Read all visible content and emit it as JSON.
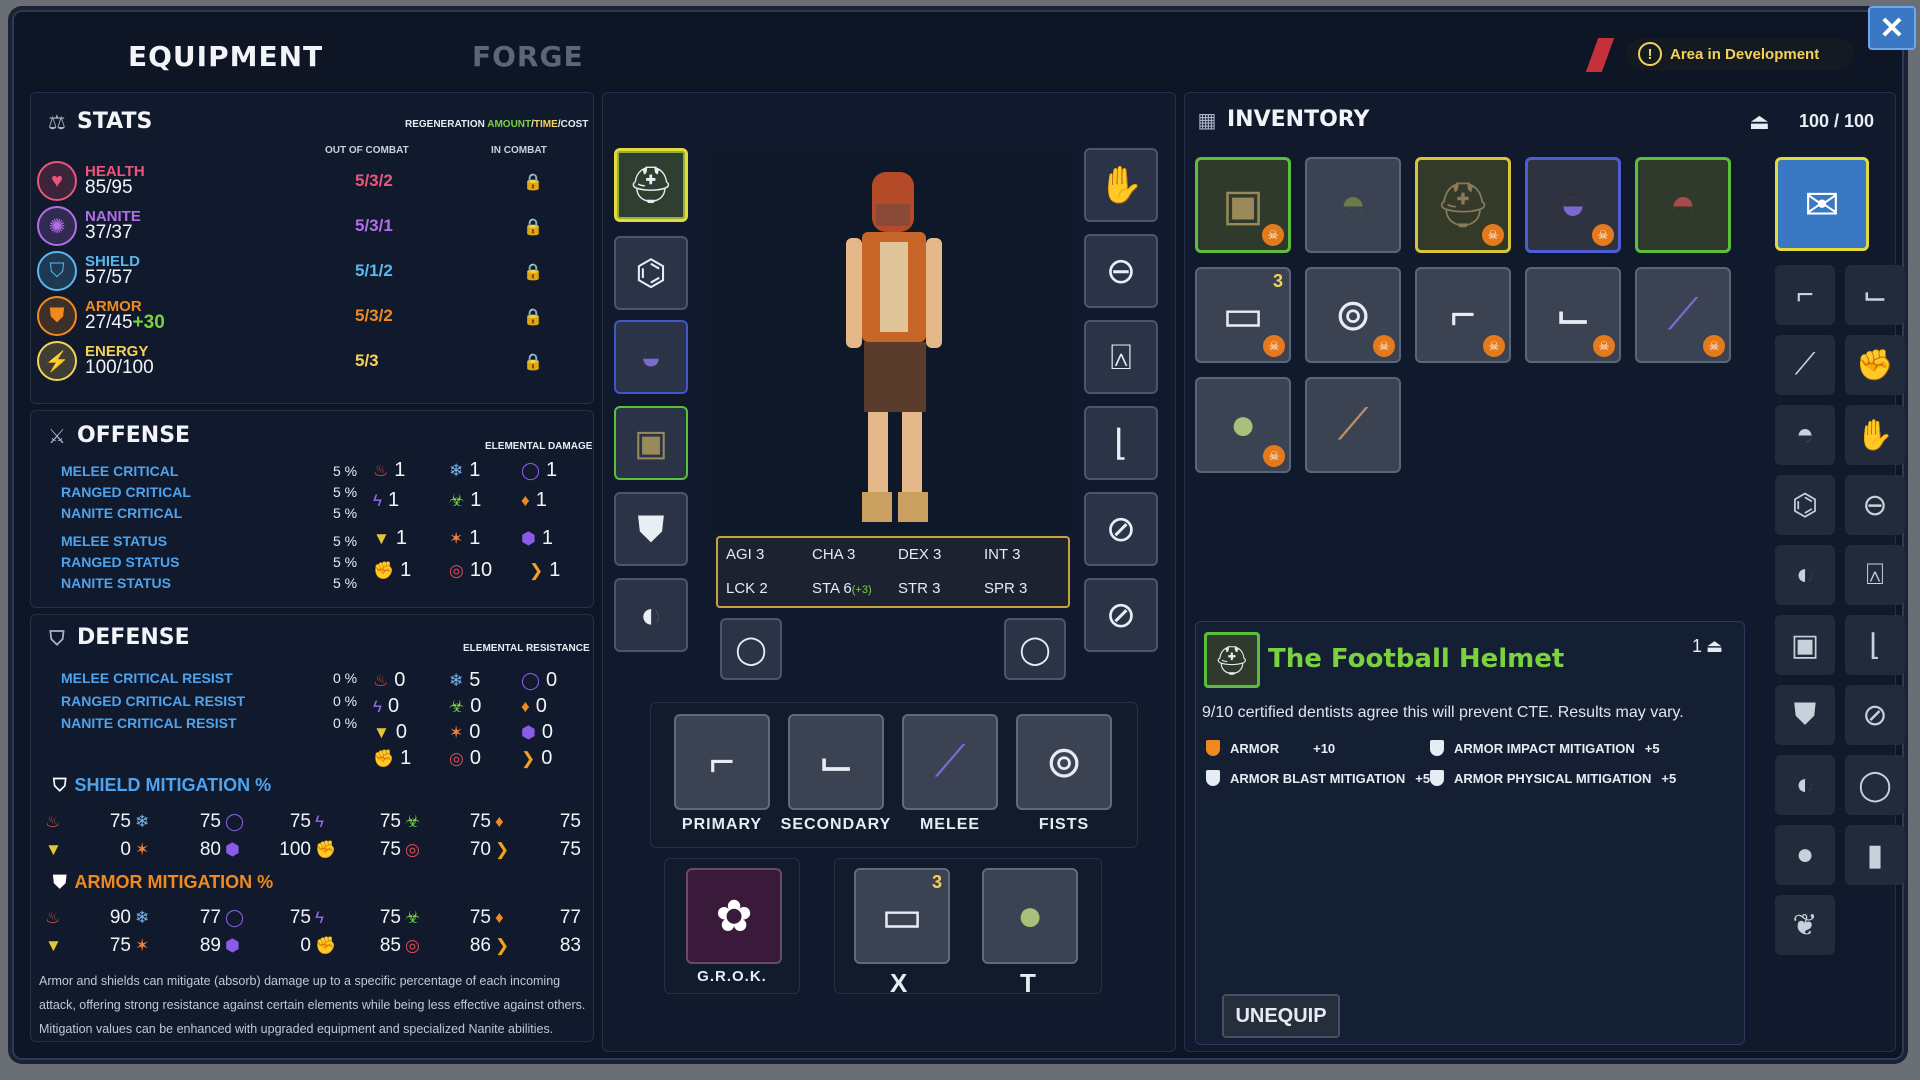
{
  "tabs": {
    "equipment": "EQUIPMENT",
    "forge": "FORGE"
  },
  "dev_notice": "Area in Development",
  "stats": {
    "title": "STATS",
    "regen_header": {
      "prefix": "REGENERATION",
      "amount": "AMOUNT",
      "sep1": "/",
      "time": "TIME",
      "sep2": "/",
      "cost": "COST"
    },
    "col_out": "OUT OF COMBAT",
    "col_in": "IN COMBAT",
    "rows": [
      {
        "name": "HEALTH",
        "value": "85/95",
        "extra": "",
        "regen": "5/3/2",
        "color": "#e9567a"
      },
      {
        "name": "NANITE",
        "value": "37/37",
        "extra": "",
        "regen": "5/3/1",
        "color": "#b26ee8"
      },
      {
        "name": "SHIELD",
        "value": "57/57",
        "extra": "",
        "regen": "5/1/2",
        "color": "#58b8ee"
      },
      {
        "name": "ARMOR",
        "value": "27/45",
        "extra": "+30",
        "regen": "5/3/2",
        "color": "#f08a1e"
      },
      {
        "name": "ENERGY",
        "value": "100/100",
        "extra": "",
        "regen": "5/3",
        "color": "#f4d25a"
      }
    ]
  },
  "offense": {
    "title": "OFFENSE",
    "subtitle": "ELEMENTAL DAMAGE",
    "rows": [
      {
        "label": "MELEE CRITICAL",
        "value": "5 %"
      },
      {
        "label": "RANGED CRITICAL",
        "value": "5 %"
      },
      {
        "label": "NANITE CRITICAL",
        "value": "5 %"
      },
      {
        "label": "MELEE STATUS",
        "value": "5 %"
      },
      {
        "label": "RANGED STATUS",
        "value": "5 %"
      },
      {
        "label": "NANITE STATUS",
        "value": "5 %"
      }
    ],
    "elements": [
      [
        "1",
        "1",
        "1"
      ],
      [
        "1",
        "1",
        "1"
      ],
      [
        "1",
        "1",
        "1"
      ],
      [
        "1",
        "10",
        "1"
      ]
    ]
  },
  "defense": {
    "title": "DEFENSE",
    "subtitle": "ELEMENTAL RESISTANCE",
    "rows": [
      {
        "label": "MELEE CRITICAL RESIST",
        "value": "0 %"
      },
      {
        "label": "RANGED CRITICAL RESIST",
        "value": "0 %"
      },
      {
        "label": "NANITE CRITICAL RESIST",
        "value": "0 %"
      }
    ],
    "elements": [
      [
        "0",
        "5",
        "0"
      ],
      [
        "0",
        "0",
        "0"
      ],
      [
        "0",
        "0",
        "0"
      ],
      [
        "1",
        "0",
        "0"
      ]
    ]
  },
  "shield_mitigation": {
    "title": "SHIELD MITIGATION %",
    "row1": [
      "75",
      "75",
      "75",
      "75",
      "75",
      "75"
    ],
    "row2": [
      "0",
      "80",
      "100",
      "75",
      "70",
      "75"
    ]
  },
  "armor_mitigation": {
    "title": "ARMOR MITIGATION %",
    "row1": [
      "90",
      "77",
      "75",
      "75",
      "75",
      "77"
    ],
    "row2": [
      "75",
      "89",
      "0",
      "85",
      "86",
      "83"
    ]
  },
  "mitigation_note": "Armor and shields can mitigate (absorb) damage up to a specific percentage of each incoming attack, offering strong resistance against certain elements while being less effective against others. Mitigation values can be enhanced with upgraded equipment and specialized Nanite abilities.",
  "attributes": [
    {
      "k": "AGI",
      "v": "3"
    },
    {
      "k": "CHA",
      "v": "3"
    },
    {
      "k": "DEX",
      "v": "3"
    },
    {
      "k": "INT",
      "v": "3"
    },
    {
      "k": "LCK",
      "v": "2"
    },
    {
      "k": "STA",
      "v": "6",
      "bonus": "(+3)"
    },
    {
      "k": "STR",
      "v": "3"
    },
    {
      "k": "SPR",
      "v": "3"
    }
  ],
  "weapons": {
    "primary": "PRIMARY",
    "secondary": "SECONDARY",
    "melee": "MELEE",
    "fists": "FISTS"
  },
  "quick": {
    "grok": "G.R.O.K.",
    "x": "X",
    "t": "T",
    "x_count": "3"
  },
  "inventory": {
    "title": "INVENTORY",
    "capacity": "100 / 100",
    "stack_count": "3"
  },
  "detail": {
    "name": "The Football Helmet",
    "count": "1",
    "description": "9/10 certified dentists agree this will prevent CTE. Results may vary.",
    "mods": [
      {
        "label": "ARMOR",
        "value": "+10"
      },
      {
        "label": "ARMOR IMPACT MITIGATION",
        "value": "+5"
      },
      {
        "label": "ARMOR BLAST MITIGATION",
        "value": "+5"
      },
      {
        "label": "ARMOR PHYSICAL MITIGATION",
        "value": "+5"
      }
    ],
    "unequip": "UNEQUIP"
  },
  "colors": {
    "accent_green": "#5bbf3d",
    "accent_yellow": "#e4da3c",
    "label_blue": "#4ea3ee",
    "orange": "#f08a1e"
  }
}
